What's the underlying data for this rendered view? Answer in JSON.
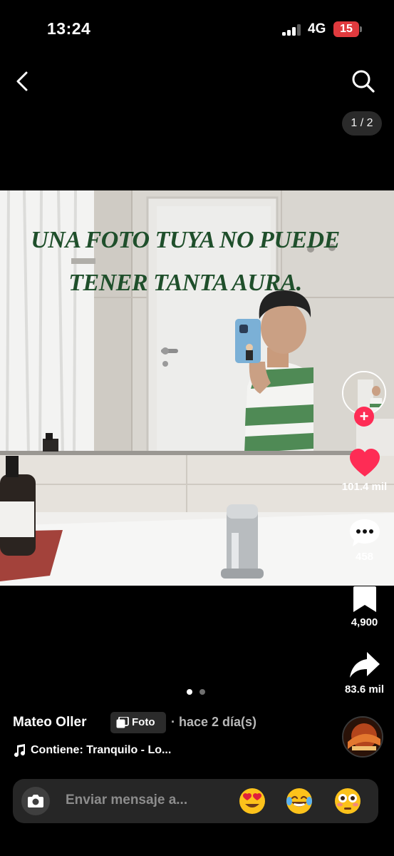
{
  "status_bar": {
    "time": "13:24",
    "network": "4G",
    "battery": "15"
  },
  "header": {
    "page_indicator": "1 / 2"
  },
  "photo": {
    "overlay_line1": "UNA FOTO TUYA NO PUEDE",
    "overlay_line2": "TENER TANTA AURA."
  },
  "actions": {
    "likes": "101.4 mil",
    "comments": "458",
    "saves": "4,900",
    "shares": "83.6 mil"
  },
  "carousel": {
    "current": 1,
    "total": 2
  },
  "post": {
    "author": "Mateo Oller",
    "type_badge": "Foto",
    "time": "· hace 2 día(s)",
    "music": "Contiene: Tranquilo - Lo..."
  },
  "comment_bar": {
    "placeholder": "Enviar mensaje a...",
    "quick_emojis": [
      "heart-eyes-emoji",
      "tears-of-joy-emoji",
      "flushed-emoji"
    ]
  },
  "colors": {
    "accent": "#fe2c55",
    "battery": "#e03a3e",
    "overlay_text": "#1f4f2b"
  }
}
